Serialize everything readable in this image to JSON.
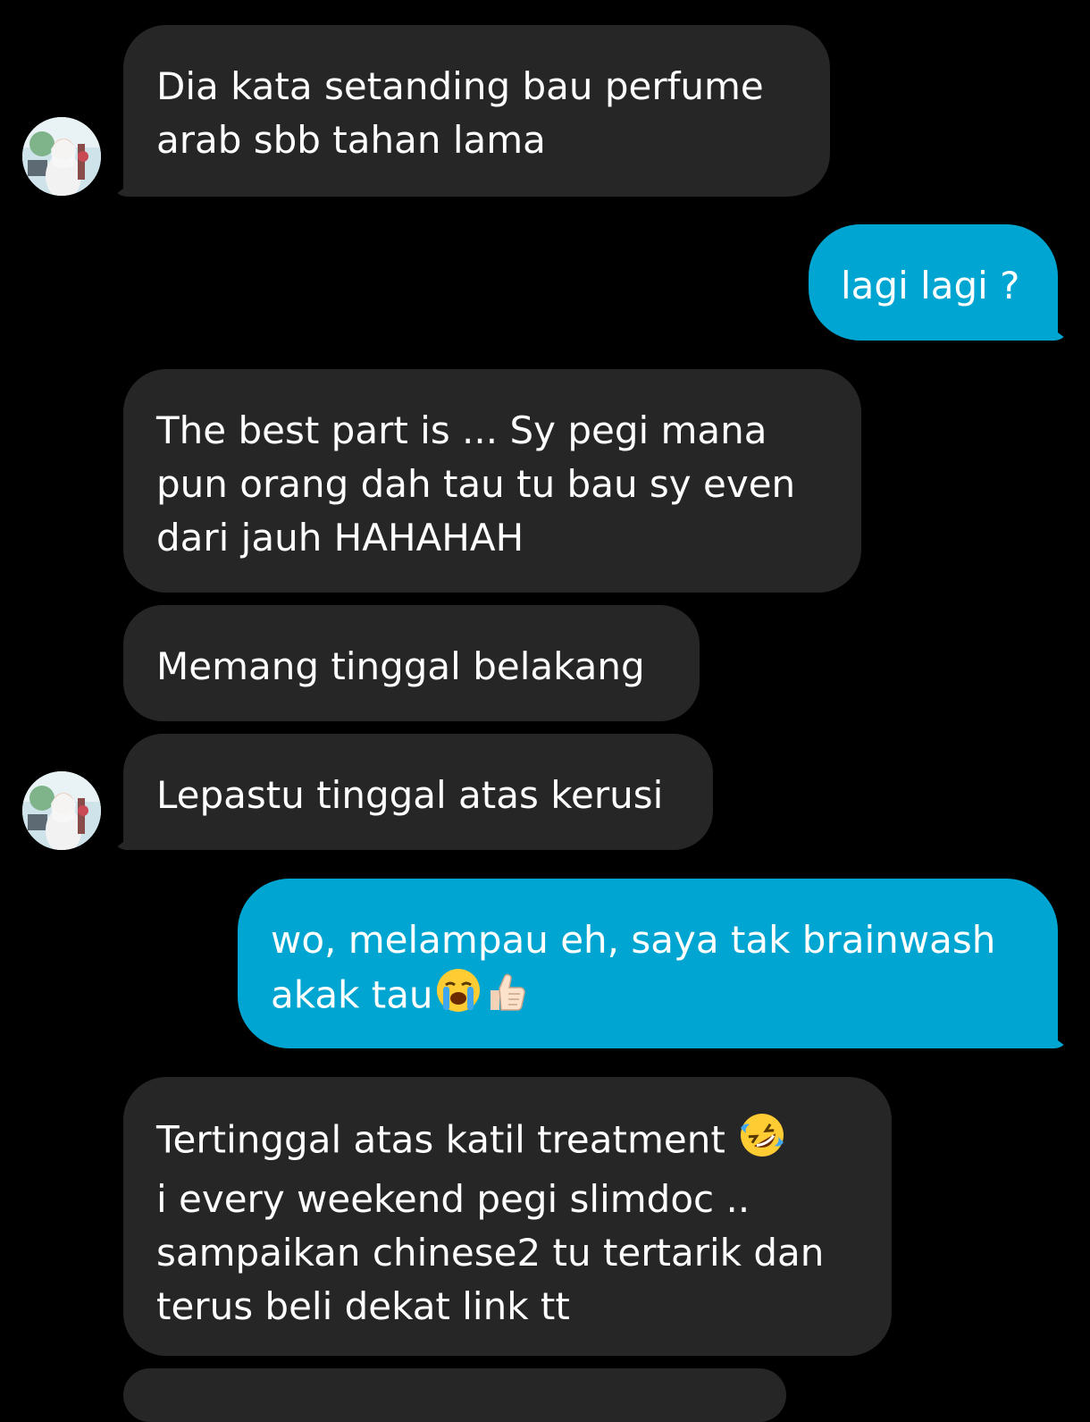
{
  "conversation": {
    "messages": [
      {
        "sender": "contact",
        "lines": [
          "Dia kata setanding bau perfume",
          "arab sbb tahan lama"
        ]
      },
      {
        "sender": "me",
        "lines": [
          "lagi lagi ?"
        ]
      },
      {
        "sender": "contact",
        "lines": [
          "The best part is ... Sy pegi mana",
          "pun orang dah tau tu bau sy even",
          "dari jauh HAHAHAH"
        ]
      },
      {
        "sender": "contact",
        "lines": [
          "Memang tinggal belakang"
        ]
      },
      {
        "sender": "contact",
        "lines": [
          "Lepastu tinggal atas kerusi"
        ]
      },
      {
        "sender": "me",
        "lines": [
          "wo, melampau eh, saya tak brainwash",
          "akak tau"
        ],
        "emojis": [
          "loudly-crying-face",
          "thumbs-up"
        ]
      },
      {
        "sender": "contact",
        "lines": [
          "Tertinggal atas katil treatment",
          "i every weekend pegi slimdoc ..",
          "sampaikan chinese2 tu tertarik dan",
          "terus beli dekat link tt"
        ],
        "emojis": [
          "rolling-on-floor-laughing"
        ]
      }
    ]
  },
  "colors": {
    "background": "#000000",
    "incoming_bubble": "#262626",
    "outgoing_bubble": "#00a6d1",
    "text": "#ffffff"
  }
}
